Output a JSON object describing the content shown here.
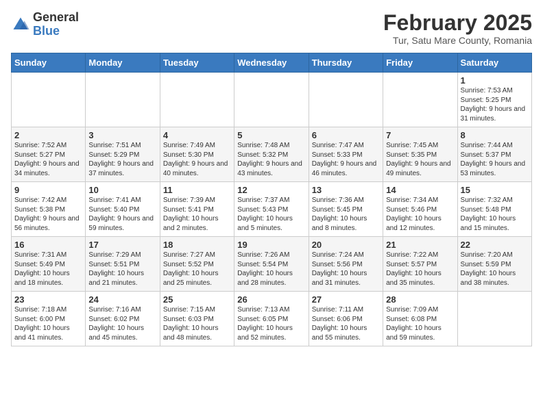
{
  "header": {
    "logo_general": "General",
    "logo_blue": "Blue",
    "month_title": "February 2025",
    "location": "Tur, Satu Mare County, Romania"
  },
  "weekdays": [
    "Sunday",
    "Monday",
    "Tuesday",
    "Wednesday",
    "Thursday",
    "Friday",
    "Saturday"
  ],
  "weeks": [
    [
      {
        "day": "",
        "info": ""
      },
      {
        "day": "",
        "info": ""
      },
      {
        "day": "",
        "info": ""
      },
      {
        "day": "",
        "info": ""
      },
      {
        "day": "",
        "info": ""
      },
      {
        "day": "",
        "info": ""
      },
      {
        "day": "1",
        "info": "Sunrise: 7:53 AM\nSunset: 5:25 PM\nDaylight: 9 hours and 31 minutes."
      }
    ],
    [
      {
        "day": "2",
        "info": "Sunrise: 7:52 AM\nSunset: 5:27 PM\nDaylight: 9 hours and 34 minutes."
      },
      {
        "day": "3",
        "info": "Sunrise: 7:51 AM\nSunset: 5:29 PM\nDaylight: 9 hours and 37 minutes."
      },
      {
        "day": "4",
        "info": "Sunrise: 7:49 AM\nSunset: 5:30 PM\nDaylight: 9 hours and 40 minutes."
      },
      {
        "day": "5",
        "info": "Sunrise: 7:48 AM\nSunset: 5:32 PM\nDaylight: 9 hours and 43 minutes."
      },
      {
        "day": "6",
        "info": "Sunrise: 7:47 AM\nSunset: 5:33 PM\nDaylight: 9 hours and 46 minutes."
      },
      {
        "day": "7",
        "info": "Sunrise: 7:45 AM\nSunset: 5:35 PM\nDaylight: 9 hours and 49 minutes."
      },
      {
        "day": "8",
        "info": "Sunrise: 7:44 AM\nSunset: 5:37 PM\nDaylight: 9 hours and 53 minutes."
      }
    ],
    [
      {
        "day": "9",
        "info": "Sunrise: 7:42 AM\nSunset: 5:38 PM\nDaylight: 9 hours and 56 minutes."
      },
      {
        "day": "10",
        "info": "Sunrise: 7:41 AM\nSunset: 5:40 PM\nDaylight: 9 hours and 59 minutes."
      },
      {
        "day": "11",
        "info": "Sunrise: 7:39 AM\nSunset: 5:41 PM\nDaylight: 10 hours and 2 minutes."
      },
      {
        "day": "12",
        "info": "Sunrise: 7:37 AM\nSunset: 5:43 PM\nDaylight: 10 hours and 5 minutes."
      },
      {
        "day": "13",
        "info": "Sunrise: 7:36 AM\nSunset: 5:45 PM\nDaylight: 10 hours and 8 minutes."
      },
      {
        "day": "14",
        "info": "Sunrise: 7:34 AM\nSunset: 5:46 PM\nDaylight: 10 hours and 12 minutes."
      },
      {
        "day": "15",
        "info": "Sunrise: 7:32 AM\nSunset: 5:48 PM\nDaylight: 10 hours and 15 minutes."
      }
    ],
    [
      {
        "day": "16",
        "info": "Sunrise: 7:31 AM\nSunset: 5:49 PM\nDaylight: 10 hours and 18 minutes."
      },
      {
        "day": "17",
        "info": "Sunrise: 7:29 AM\nSunset: 5:51 PM\nDaylight: 10 hours and 21 minutes."
      },
      {
        "day": "18",
        "info": "Sunrise: 7:27 AM\nSunset: 5:52 PM\nDaylight: 10 hours and 25 minutes."
      },
      {
        "day": "19",
        "info": "Sunrise: 7:26 AM\nSunset: 5:54 PM\nDaylight: 10 hours and 28 minutes."
      },
      {
        "day": "20",
        "info": "Sunrise: 7:24 AM\nSunset: 5:56 PM\nDaylight: 10 hours and 31 minutes."
      },
      {
        "day": "21",
        "info": "Sunrise: 7:22 AM\nSunset: 5:57 PM\nDaylight: 10 hours and 35 minutes."
      },
      {
        "day": "22",
        "info": "Sunrise: 7:20 AM\nSunset: 5:59 PM\nDaylight: 10 hours and 38 minutes."
      }
    ],
    [
      {
        "day": "23",
        "info": "Sunrise: 7:18 AM\nSunset: 6:00 PM\nDaylight: 10 hours and 41 minutes."
      },
      {
        "day": "24",
        "info": "Sunrise: 7:16 AM\nSunset: 6:02 PM\nDaylight: 10 hours and 45 minutes."
      },
      {
        "day": "25",
        "info": "Sunrise: 7:15 AM\nSunset: 6:03 PM\nDaylight: 10 hours and 48 minutes."
      },
      {
        "day": "26",
        "info": "Sunrise: 7:13 AM\nSunset: 6:05 PM\nDaylight: 10 hours and 52 minutes."
      },
      {
        "day": "27",
        "info": "Sunrise: 7:11 AM\nSunset: 6:06 PM\nDaylight: 10 hours and 55 minutes."
      },
      {
        "day": "28",
        "info": "Sunrise: 7:09 AM\nSunset: 6:08 PM\nDaylight: 10 hours and 59 minutes."
      },
      {
        "day": "",
        "info": ""
      }
    ]
  ]
}
